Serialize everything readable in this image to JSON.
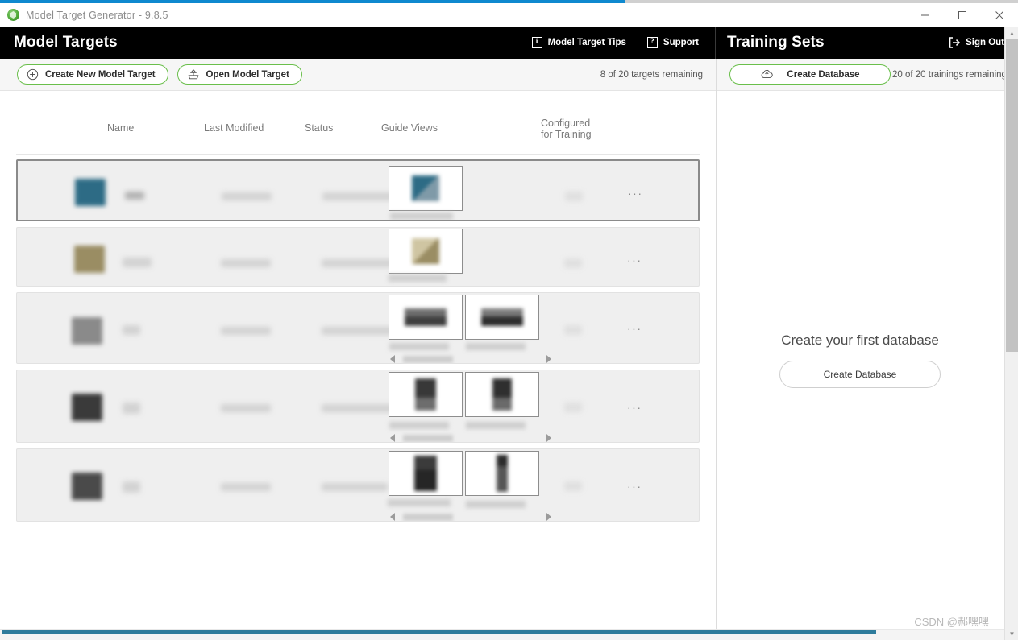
{
  "window": {
    "title": "Model Target Generator - 9.8.5",
    "app_icon": "vuforia-cube-icon",
    "controls": {
      "minimize": "minimize-icon",
      "maximize": "maximize-icon",
      "close": "close-icon"
    },
    "progress_percent": 61
  },
  "header": {
    "left_title": "Model Targets",
    "right_title": "Training Sets",
    "actions": [
      {
        "label": "Model Target Tips",
        "icon": "info-icon",
        "glyph": "i"
      },
      {
        "label": "Support",
        "icon": "help-icon",
        "glyph": "?"
      }
    ],
    "sign_out": {
      "label": "Sign Out",
      "icon": "sign-out-icon"
    }
  },
  "toolbar": {
    "create_new_label": "Create New Model Target",
    "create_new_icon": "plus-circle-icon",
    "open_label": "Open Model Target",
    "open_icon": "open-folder-upload-icon",
    "targets_remaining": "8 of 20 targets remaining"
  },
  "training_toolbar": {
    "create_database_label": "Create Database",
    "create_database_icon": "cloud-upload-icon",
    "trainings_remaining": "20 of 20 trainings remaining"
  },
  "table": {
    "columns": [
      {
        "label": "Name"
      },
      {
        "label": "Last Modified"
      },
      {
        "label": "Status"
      },
      {
        "label": "Guide Views"
      },
      {
        "label_line1": "Configured",
        "label_line2": "for Training"
      }
    ],
    "rows": [
      {
        "selected": true,
        "guide_view_count": 1,
        "has_carousel": false,
        "menu": "···",
        "thumb_color": "#2d6b85"
      },
      {
        "selected": false,
        "guide_view_count": 1,
        "has_carousel": false,
        "menu": "···",
        "thumb_color": "#9a8d63"
      },
      {
        "selected": false,
        "guide_view_count": 2,
        "has_carousel": true,
        "menu": "···",
        "thumb_color": "#8a8a8a"
      },
      {
        "selected": false,
        "guide_view_count": 2,
        "has_carousel": true,
        "menu": "···",
        "thumb_color": "#3a3a3a"
      },
      {
        "selected": false,
        "guide_view_count": 2,
        "has_carousel": true,
        "menu": "···",
        "thumb_color": "#4a4a4a"
      }
    ]
  },
  "training_panel": {
    "empty_title": "Create your first database",
    "empty_button": "Create Database"
  },
  "watermark": "CSDN @郝嘿嘿",
  "colors": {
    "accent_blue": "#0f89cf",
    "header_black": "#000000",
    "pill_green": "#6abf4b",
    "row_bg": "#efefef",
    "scroll_thumb": "#c2c2c2",
    "hscroll_thumb": "#2e7c9c"
  }
}
